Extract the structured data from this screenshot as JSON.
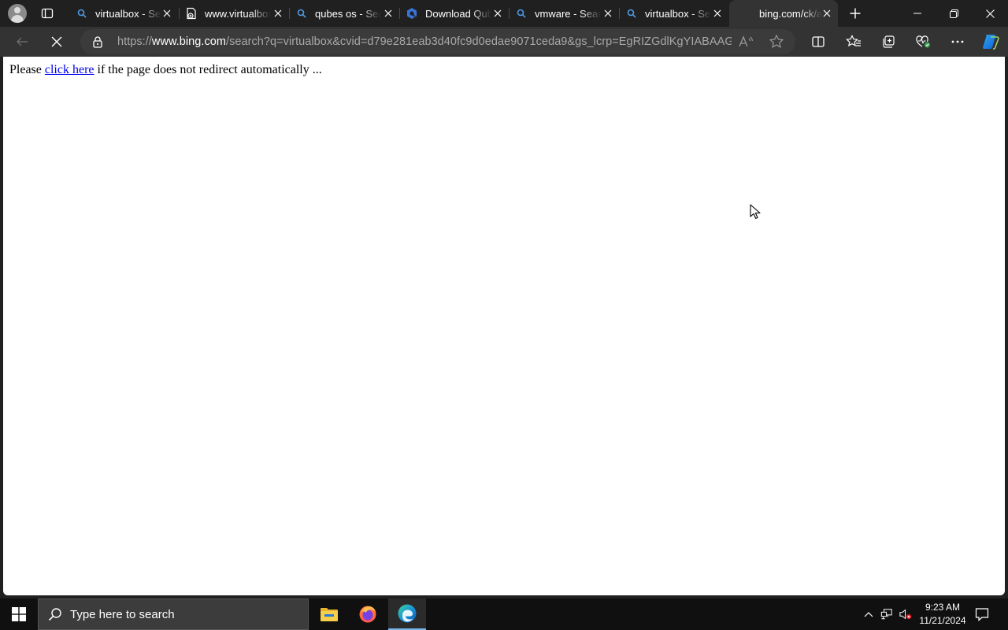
{
  "browser": {
    "tabs": [
      {
        "label": "virtualbox - Search",
        "icon": "search-icon"
      },
      {
        "label": "www.virtualbox.org",
        "icon": "page-icon"
      },
      {
        "label": "qubes os - Search",
        "icon": "search-icon"
      },
      {
        "label": "Download Qubes OS",
        "icon": "qubes-icon"
      },
      {
        "label": "vmware - Search",
        "icon": "search-icon"
      },
      {
        "label": "virtualbox - Search",
        "icon": "search-icon"
      },
      {
        "label": "bing.com/ck/a?!",
        "icon": "none",
        "active": true
      }
    ],
    "address_bar": {
      "url_prefix": "https://",
      "url_host": "www.bing.com",
      "url_rest": "/search?q=virtualbox&cvid=d79e281eab3d40fc9d0edae9071ceda9&gs_lcrp=EgRIZGdlKgYIABAAGEA..."
    },
    "accent_color": "#0078d4"
  },
  "page": {
    "text_before": "Please ",
    "link_text": "click here",
    "text_after": " if the page does not redirect automatically ..."
  },
  "taskbar": {
    "search_placeholder": "Type here to search",
    "time": "9:23 AM",
    "date": "11/21/2024"
  }
}
